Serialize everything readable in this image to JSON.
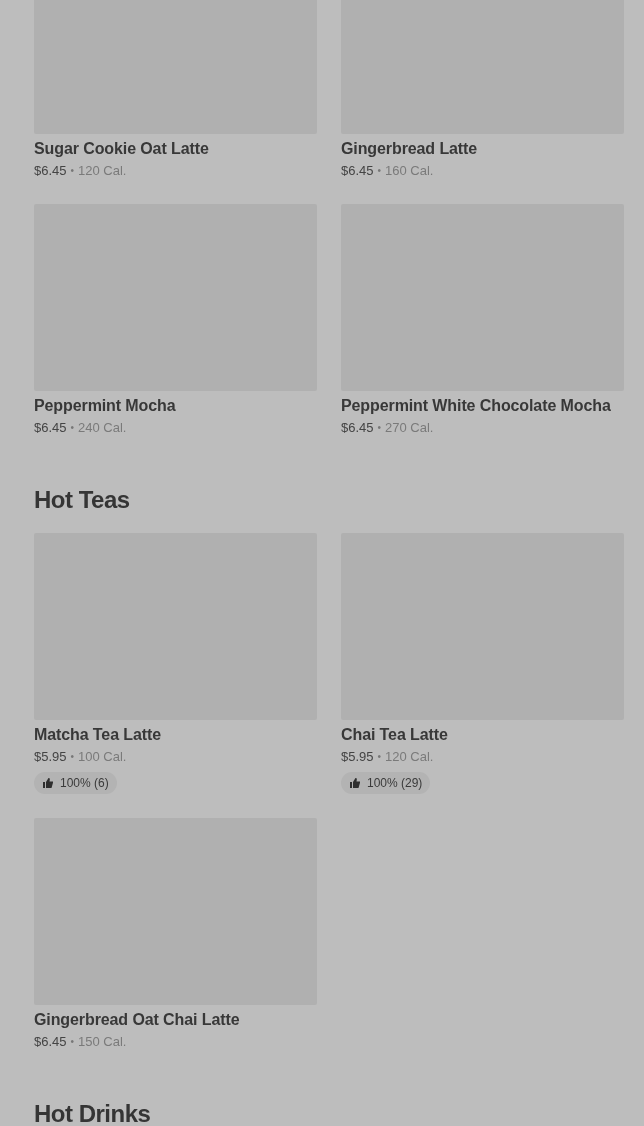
{
  "sections": [
    {
      "items": [
        {
          "name": "Sugar Cookie Oat Latte",
          "price": "$6.45",
          "separator": "•",
          "calories": "120 Cal."
        },
        {
          "name": "Gingerbread Latte",
          "price": "$6.45",
          "separator": "•",
          "calories": "160 Cal."
        },
        {
          "name": "Peppermint Mocha",
          "price": "$6.45",
          "separator": "•",
          "calories": "240 Cal."
        },
        {
          "name": "Peppermint White Chocolate Mocha",
          "price": "$6.45",
          "separator": "•",
          "calories": "270 Cal."
        }
      ]
    },
    {
      "title": "Hot Teas",
      "items": [
        {
          "name": "Matcha Tea Latte",
          "price": "$5.95",
          "separator": "•",
          "calories": "100 Cal.",
          "rating": "100% (6)"
        },
        {
          "name": "Chai Tea Latte",
          "price": "$5.95",
          "separator": "•",
          "calories": "120 Cal.",
          "rating": "100% (29)"
        },
        {
          "name": "Gingerbread Oat Chai Latte",
          "price": "$6.45",
          "separator": "•",
          "calories": "150 Cal."
        }
      ]
    },
    {
      "title": "Hot Drinks"
    }
  ]
}
